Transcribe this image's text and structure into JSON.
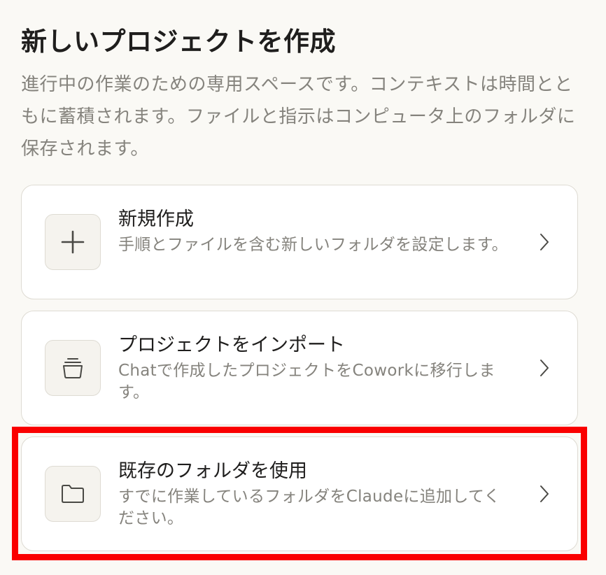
{
  "header": {
    "title": "新しいプロジェクトを作成",
    "description": "進行中の作業のための専用スペースです。コンテキストは時間とともに蓄積されます。ファイルと指示はコンピュータ上のフォルダに保存されます。"
  },
  "options": [
    {
      "title": "新規作成",
      "description": "手順とファイルを含む新しいフォルダを設定します。",
      "icon": "plus-icon"
    },
    {
      "title": "プロジェクトをインポート",
      "description": "Chatで作成したプロジェクトをCoworkに移行します。",
      "icon": "import-stack-icon"
    },
    {
      "title": "既存のフォルダを使用",
      "description": "すでに作業しているフォルダをClaudeに追加してください。",
      "icon": "folder-icon"
    }
  ],
  "colors": {
    "background": "#faf9f5",
    "card_background": "#ffffff",
    "border": "#dedbd3",
    "muted_text": "#85837d",
    "highlight": "#fa0000"
  }
}
